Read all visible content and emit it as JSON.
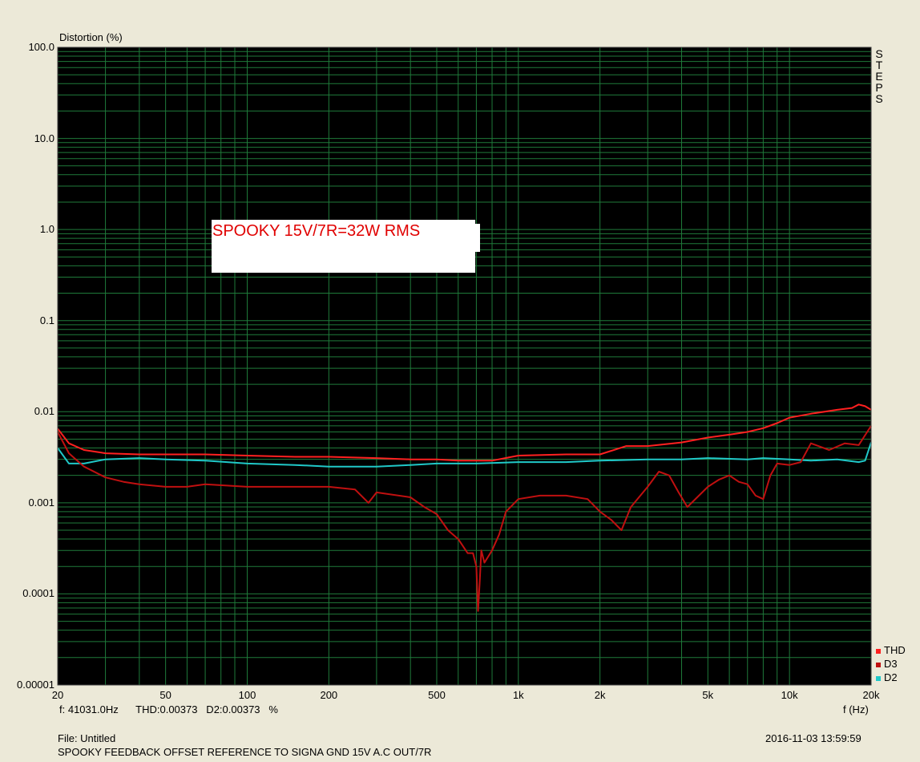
{
  "chart_data": {
    "type": "line",
    "ylabel": "Distortion (%)",
    "xlabel": "f (Hz)",
    "y_scale": "log",
    "x_scale": "log",
    "xlim": [
      20,
      20000
    ],
    "ylim": [
      1e-05,
      100
    ],
    "y_ticks": [
      "100.0",
      "10.0",
      "1.0",
      "0.1",
      "0.01",
      "0.001",
      "0.0001",
      "0.00001"
    ],
    "x_ticks": [
      {
        "value": 20,
        "label": "20"
      },
      {
        "value": 50,
        "label": "50"
      },
      {
        "value": 100,
        "label": "100"
      },
      {
        "value": 200,
        "label": "200"
      },
      {
        "value": 500,
        "label": "500"
      },
      {
        "value": 1000,
        "label": "1k"
      },
      {
        "value": 2000,
        "label": "2k"
      },
      {
        "value": 5000,
        "label": "5k"
      },
      {
        "value": 10000,
        "label": "10k"
      },
      {
        "value": 20000,
        "label": "20k"
      }
    ],
    "grid": true,
    "background": "#000000",
    "grid_color": "#1f7a3a",
    "legend_position": "bottom-right",
    "annotation": "SPOOKY 15V/7R=32W RMS",
    "series": [
      {
        "name": "THD",
        "color": "#ff2020",
        "x": [
          20,
          22,
          25,
          30,
          40,
          50,
          70,
          100,
          150,
          200,
          300,
          400,
          500,
          600,
          700,
          800,
          1000,
          1500,
          2000,
          2500,
          3000,
          4000,
          5000,
          6000,
          7000,
          8000,
          9000,
          10000,
          12000,
          15000,
          17000,
          18000,
          19000,
          20000
        ],
        "y": [
          0.0065,
          0.0045,
          0.0038,
          0.0035,
          0.0034,
          0.0034,
          0.0034,
          0.0033,
          0.0032,
          0.0032,
          0.0031,
          0.003,
          0.003,
          0.0029,
          0.0029,
          0.0029,
          0.0033,
          0.0034,
          0.0034,
          0.0042,
          0.0042,
          0.0046,
          0.0052,
          0.0056,
          0.006,
          0.0066,
          0.0075,
          0.0086,
          0.0095,
          0.0105,
          0.011,
          0.012,
          0.0115,
          0.0105
        ]
      },
      {
        "name": "D3",
        "color": "#c01010",
        "x": [
          20,
          22,
          25,
          30,
          35,
          40,
          50,
          60,
          70,
          100,
          150,
          200,
          250,
          280,
          300,
          400,
          450,
          500,
          550,
          600,
          650,
          680,
          700,
          710,
          720,
          730,
          750,
          800,
          850,
          900,
          1000,
          1200,
          1500,
          1800,
          2000,
          2200,
          2400,
          2600,
          3000,
          3300,
          3600,
          3900,
          4200,
          5000,
          5500,
          6000,
          6500,
          7000,
          7500,
          8000,
          8500,
          9000,
          10000,
          11000,
          12000,
          14000,
          16000,
          18000,
          20000
        ],
        "y": [
          0.006,
          0.0035,
          0.0025,
          0.0019,
          0.0017,
          0.0016,
          0.0015,
          0.0015,
          0.0016,
          0.0015,
          0.0015,
          0.0015,
          0.0014,
          0.001,
          0.0013,
          0.00115,
          0.0009,
          0.00075,
          0.0005,
          0.0004,
          0.00028,
          0.00028,
          0.0002,
          6.5e-05,
          0.00013,
          0.0003,
          0.00022,
          0.0003,
          0.00045,
          0.0008,
          0.0011,
          0.0012,
          0.0012,
          0.0011,
          0.0008,
          0.00065,
          0.0005,
          0.0009,
          0.0015,
          0.0022,
          0.002,
          0.0013,
          0.0009,
          0.0015,
          0.0018,
          0.002,
          0.0017,
          0.0016,
          0.0012,
          0.0011,
          0.002,
          0.0027,
          0.0026,
          0.0028,
          0.0045,
          0.0038,
          0.0045,
          0.0043,
          0.007
        ]
      },
      {
        "name": "D2",
        "color": "#20c8c8",
        "x": [
          20,
          22,
          25,
          30,
          40,
          50,
          70,
          100,
          150,
          200,
          300,
          400,
          500,
          700,
          1000,
          1500,
          2000,
          3000,
          4000,
          5000,
          7000,
          8000,
          10000,
          12000,
          15000,
          18000,
          19000,
          20000
        ],
        "y": [
          0.004,
          0.0027,
          0.0027,
          0.003,
          0.0031,
          0.003,
          0.0029,
          0.0027,
          0.0026,
          0.0025,
          0.0025,
          0.0026,
          0.0027,
          0.0027,
          0.0028,
          0.0028,
          0.0029,
          0.003,
          0.003,
          0.0031,
          0.003,
          0.0031,
          0.003,
          0.0029,
          0.003,
          0.0028,
          0.0029,
          0.0046
        ]
      }
    ]
  },
  "side_label": [
    "S",
    "T",
    "E",
    "P",
    "S"
  ],
  "status": {
    "cursor": "f: 41031.0Hz      THD:0.00373   D2:0.00373   %",
    "file": "File: Untitled",
    "timestamp": "2016-11-03 13:59:59",
    "comment": "SPOOKY FEEDBACK OFFSET REFERENCE TO SIGNA GND 15V A.C OUT/7R"
  }
}
